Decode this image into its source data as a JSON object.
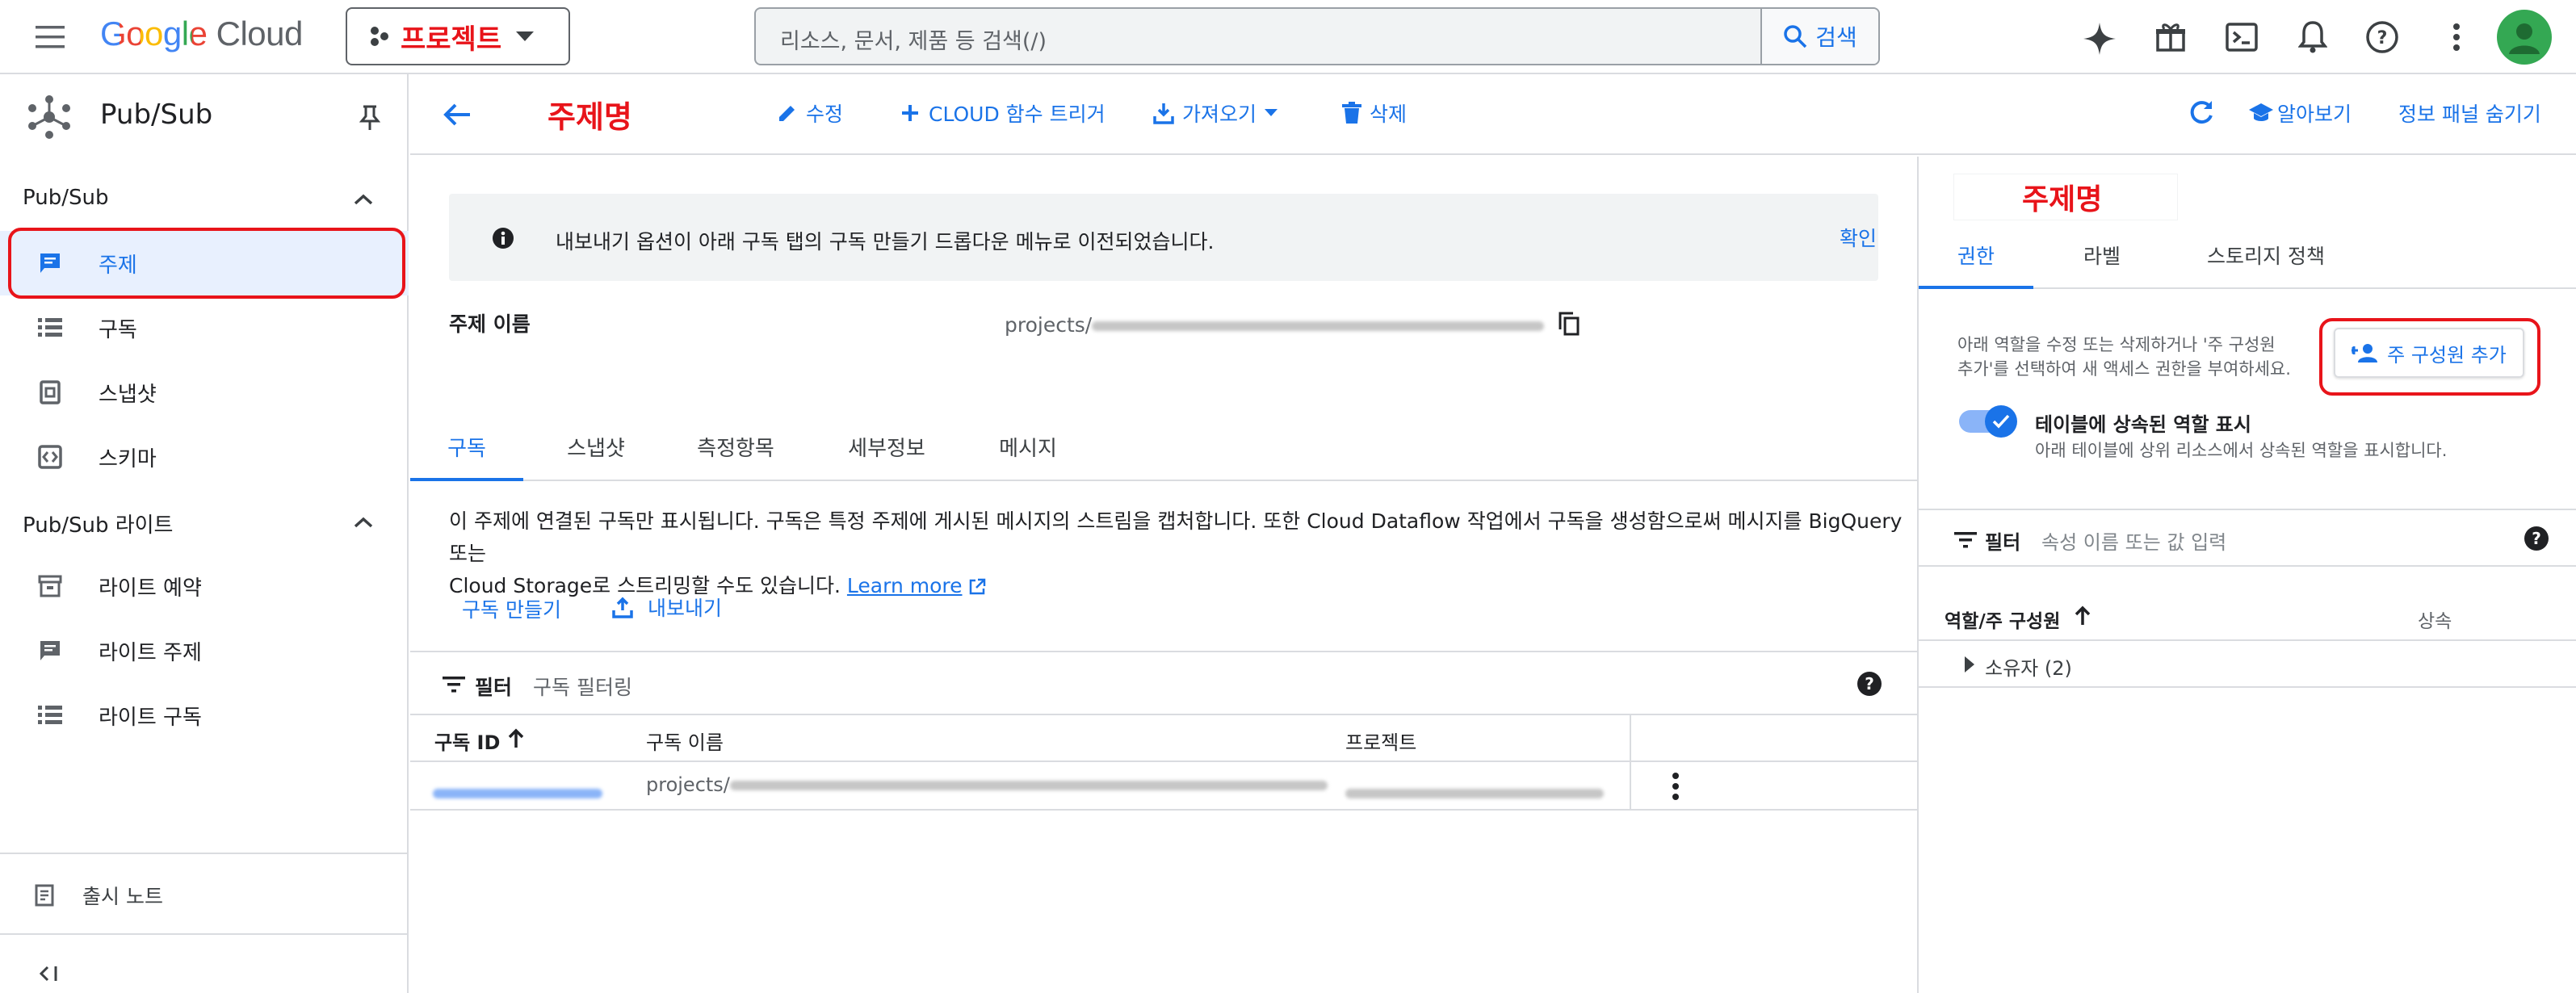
{
  "topbar": {
    "logo_google": "Google",
    "logo_cloud": "Cloud",
    "project_label": "프로젝트",
    "search_placeholder": "리소스, 문서, 제품 등 검색(/)",
    "search_button": "검색"
  },
  "sidebar": {
    "product_title": "Pub/Sub",
    "section1_title": "Pub/Sub",
    "items": [
      {
        "label": "주제",
        "icon": "topic-icon",
        "active": true
      },
      {
        "label": "구독",
        "icon": "list-icon"
      },
      {
        "label": "스냅샷",
        "icon": "snapshot-icon"
      },
      {
        "label": "스키마",
        "icon": "schema-icon"
      }
    ],
    "section2_title": "Pub/Sub 라이트",
    "lite_items": [
      {
        "label": "라이트 예약",
        "icon": "reservation-icon"
      },
      {
        "label": "라이트 주제",
        "icon": "topic-icon"
      },
      {
        "label": "라이트 구독",
        "icon": "list-icon"
      }
    ],
    "release_notes": "출시 노트"
  },
  "actionbar": {
    "page_title": "주제명",
    "edit": "수정",
    "cloud_function": "CLOUD 함수 트리거",
    "import": "가져오기",
    "delete": "삭제",
    "learn": "알아보기",
    "hide_panel": "정보 패널 숨기기"
  },
  "main": {
    "banner_text": "내보내기 옵션이 아래 구독 탭의 구독 만들기 드롭다운 메뉴로 이전되었습니다.",
    "banner_confirm": "확인",
    "topic_name_label": "주제 이름",
    "topic_name_value": "projects/",
    "tabs": [
      "구독",
      "스냅샷",
      "측정항목",
      "세부정보",
      "메시지"
    ],
    "description_line1": "이 주제에 연결된 구독만 표시됩니다. 구독은 특정 주제에 게시된 메시지의 스트림을 캡처합니다. 또한 Cloud Dataflow 작업에서 구독을 생성함으로써 메시지를 BigQuery 또는",
    "description_line2": "Cloud Storage로 스트리밍할 수도 있습니다.",
    "learn_more": "Learn more",
    "create_subscription": "구독 만들기",
    "export": "내보내기",
    "filter_label": "필터",
    "filter_placeholder": "구독 필터링",
    "columns": [
      "구독 ID",
      "구독 이름",
      "프로젝트"
    ],
    "row": {
      "name_prefix": "projects/"
    }
  },
  "rpanel": {
    "title": "주제명",
    "tabs": [
      "권한",
      "라벨",
      "스토리지 정책"
    ],
    "help_text_line1": "아래 역할을 수정 또는 삭제하거나 '주 구성원",
    "help_text_line2": "추가'를 선택하여 새 액세스 권한을 부여하세요.",
    "add_principal": "주 구성원 추가",
    "toggle_label": "테이블에 상속된 역할 표시",
    "toggle_desc": "아래 테이블에 상위 리소스에서 상속된 역할을 표시합니다.",
    "filter_label": "필터",
    "filter_placeholder": "속성 이름 또는 값 입력",
    "col_role": "역할/주 구성원",
    "col_inherit": "상속",
    "owner_row": "소유자 (2)"
  },
  "colors": {
    "accent": "#1a73e8",
    "annotation_red": "#e8141a",
    "avatar_green": "#34a853"
  }
}
